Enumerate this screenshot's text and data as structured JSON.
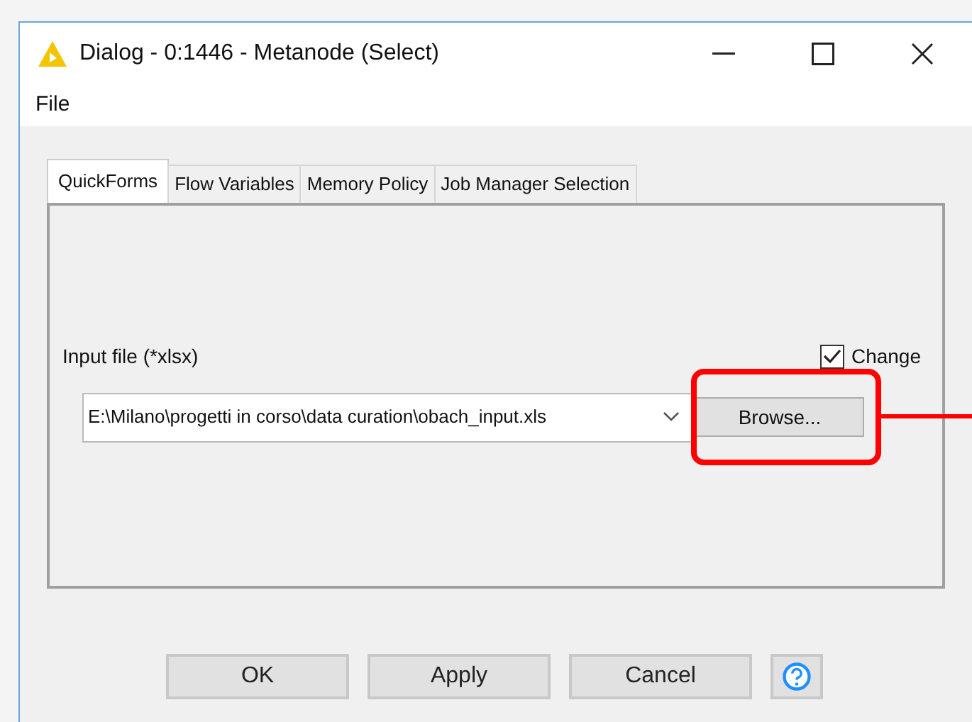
{
  "window": {
    "title": "Dialog - 0:1446 - Metanode (Select)"
  },
  "menu": [
    "File"
  ],
  "tabs": [
    {
      "label": "QuickForms",
      "selected": true
    },
    {
      "label": "Flow Variables",
      "selected": false
    },
    {
      "label": "Memory Policy",
      "selected": false
    },
    {
      "label": "Job Manager Selection",
      "selected": false
    }
  ],
  "input_file": {
    "label": "Input file (*xlsx)",
    "change": {
      "label": "Change",
      "checked": true
    },
    "value": "E:\\Milano\\progetti in corso\\data curation\\obach_input.xls",
    "browse": {
      "label": "Browse...",
      "highlighted": true
    }
  },
  "buttons": [
    "OK",
    "Apply",
    "Cancel"
  ]
}
